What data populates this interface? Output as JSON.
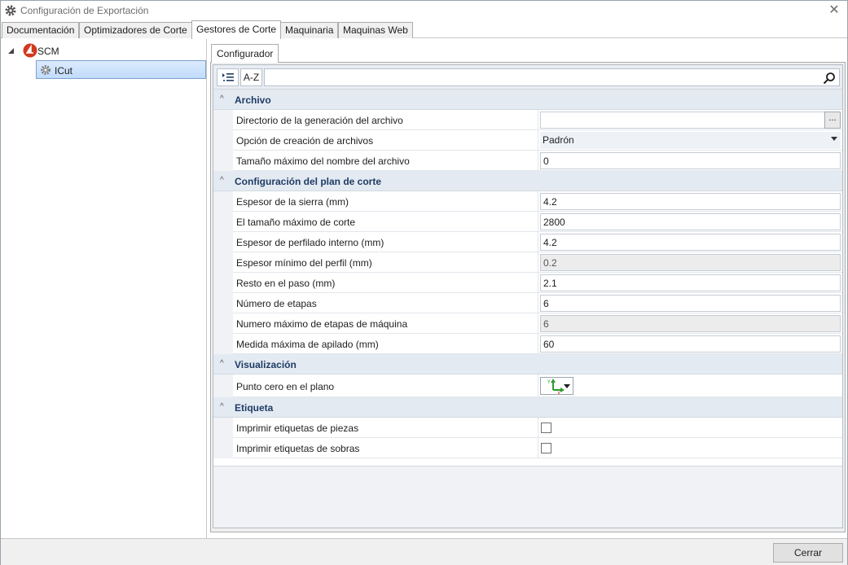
{
  "window": {
    "title": "Configuración de Exportación",
    "icon": "gear-icon",
    "close_icon": "close-icon"
  },
  "tabs": [
    {
      "label": "Documentación",
      "active": false
    },
    {
      "label": "Optimizadores de Corte",
      "active": false
    },
    {
      "label": "Gestores de Corte",
      "active": true
    },
    {
      "label": "Maquinaria",
      "active": false
    },
    {
      "label": "Maquinas Web",
      "active": false
    }
  ],
  "tree": {
    "root": {
      "label": "SCM",
      "icon": "scm-logo-icon",
      "expanded": true
    },
    "child": {
      "label": "ICut",
      "icon": "gear-icon",
      "selected": true
    }
  },
  "subtab": {
    "label": "Configurador"
  },
  "toolbar": {
    "categorized_icon": "categorized-view-icon",
    "az_label": "A-Z",
    "search_value": "",
    "search_icon": "search-icon"
  },
  "categories": [
    {
      "name": "Archivo",
      "rows": [
        {
          "label": "Directorio de la generación del archivo",
          "type": "browse",
          "value": "",
          "button": "..."
        },
        {
          "label": "Opción de creación de archivos",
          "type": "combo",
          "value": "Padrón"
        },
        {
          "label": "Tamaño máximo del nombre del archivo",
          "type": "text",
          "value": "0"
        }
      ]
    },
    {
      "name": "Configuración del plan de corte",
      "rows": [
        {
          "label": "Espesor de la sierra (mm)",
          "type": "text",
          "value": "4.2"
        },
        {
          "label": "El tamaño máximo de corte",
          "type": "text",
          "value": "2800"
        },
        {
          "label": "Espesor de perfilado interno (mm)",
          "type": "text",
          "value": "4.2"
        },
        {
          "label": "Espesor mínimo del perfil (mm)",
          "type": "readonly",
          "value": "0.2"
        },
        {
          "label": "Resto en el paso (mm)",
          "type": "text",
          "value": "2.1"
        },
        {
          "label": "Número de etapas",
          "type": "text",
          "value": "6"
        },
        {
          "label": "Numero máximo de etapas de máquina",
          "type": "readonly",
          "value": "6"
        },
        {
          "label": "Medida máxima de apilado (mm)",
          "type": "text",
          "value": "60"
        }
      ]
    },
    {
      "name": "Visualización",
      "rows": [
        {
          "label": "Punto cero en el plano",
          "type": "axis",
          "value": "",
          "icon": "axis-origin-icon",
          "axis_y": "Y",
          "axis_x": "X"
        }
      ]
    },
    {
      "name": "Etiqueta",
      "rows": [
        {
          "label": "Imprimir etiquetas de piezas",
          "type": "checkbox",
          "checked": false
        },
        {
          "label": "Imprimir etiquetas de sobras",
          "type": "checkbox",
          "checked": false
        }
      ]
    }
  ],
  "footer": {
    "close_label": "Cerrar"
  }
}
